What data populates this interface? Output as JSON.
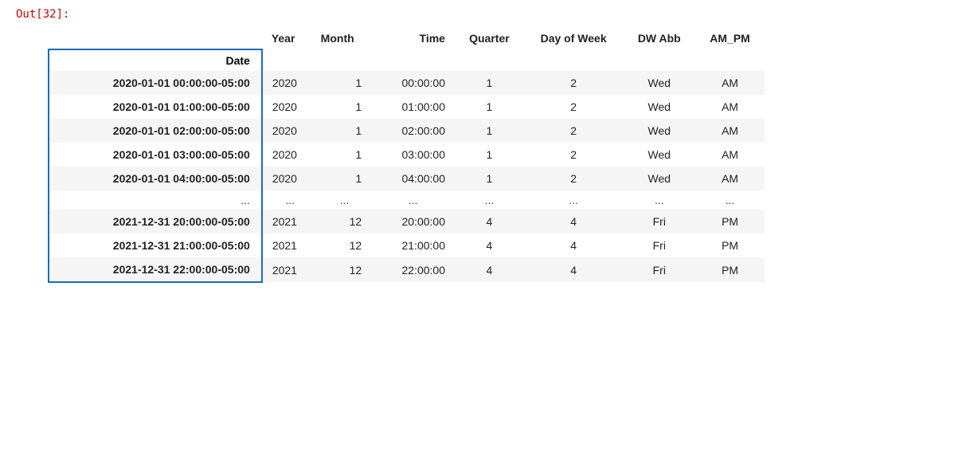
{
  "out_label": "Out[32]:",
  "columns": {
    "date": "Date",
    "year_month": "Year  Month",
    "year": "Year",
    "month": "Month",
    "time": "Time",
    "quarter": "Quarter",
    "dow": "Day of Week",
    "dwabb": "DW Abb",
    "ampm": "AM_PM"
  },
  "rows": [
    {
      "date": "2020-01-01 00:00:00-05:00",
      "year": "2020",
      "month": "1",
      "time": "00:00:00",
      "quarter": "1",
      "dow": "2",
      "dwabb": "Wed",
      "ampm": "AM"
    },
    {
      "date": "2020-01-01 01:00:00-05:00",
      "year": "2020",
      "month": "1",
      "time": "01:00:00",
      "quarter": "1",
      "dow": "2",
      "dwabb": "Wed",
      "ampm": "AM"
    },
    {
      "date": "2020-01-01 02:00:00-05:00",
      "year": "2020",
      "month": "1",
      "time": "02:00:00",
      "quarter": "1",
      "dow": "2",
      "dwabb": "Wed",
      "ampm": "AM"
    },
    {
      "date": "2020-01-01 03:00:00-05:00",
      "year": "2020",
      "month": "1",
      "time": "03:00:00",
      "quarter": "1",
      "dow": "2",
      "dwabb": "Wed",
      "ampm": "AM"
    },
    {
      "date": "2020-01-01 04:00:00-05:00",
      "year": "2020",
      "month": "1",
      "time": "04:00:00",
      "quarter": "1",
      "dow": "2",
      "dwabb": "Wed",
      "ampm": "AM"
    },
    "ellipsis",
    {
      "date": "2021-12-31 20:00:00-05:00",
      "year": "2021",
      "month": "12",
      "time": "20:00:00",
      "quarter": "4",
      "dow": "4",
      "dwabb": "Fri",
      "ampm": "PM"
    },
    {
      "date": "2021-12-31 21:00:00-05:00",
      "year": "2021",
      "month": "12",
      "time": "21:00:00",
      "quarter": "4",
      "dow": "4",
      "dwabb": "Fri",
      "ampm": "PM"
    },
    {
      "date": "2021-12-31 22:00:00-05:00",
      "year": "2021",
      "month": "12",
      "time": "22:00:00",
      "quarter": "4",
      "dow": "4",
      "dwabb": "Fri",
      "ampm": "PM"
    }
  ]
}
